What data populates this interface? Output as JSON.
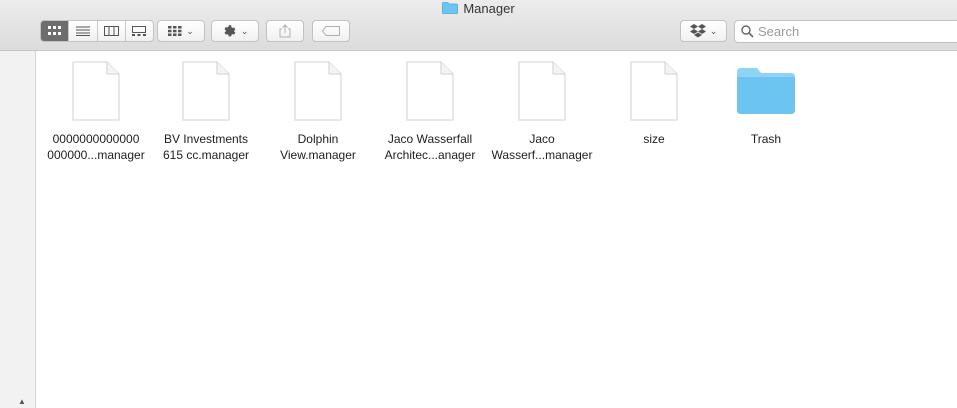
{
  "window": {
    "title": "Manager"
  },
  "toolbar": {
    "view_modes": [
      {
        "name": "icon-view",
        "active": true
      },
      {
        "name": "list-view",
        "active": false
      },
      {
        "name": "column-view",
        "active": false
      },
      {
        "name": "gallery-view",
        "active": false
      }
    ],
    "buttons": [
      "group-by",
      "action-gear",
      "share",
      "tags",
      "dropbox"
    ]
  },
  "search": {
    "placeholder": "Search",
    "value": ""
  },
  "files": [
    {
      "label": "0000000000000\n000000...manager",
      "kind": "document"
    },
    {
      "label": "BV Investments\n615 cc.manager",
      "kind": "document"
    },
    {
      "label": "Dolphin\nView.manager",
      "kind": "document"
    },
    {
      "label": "Jaco Wasserfall\nArchitec...anager",
      "kind": "document"
    },
    {
      "label": "Jaco\nWasserf...manager",
      "kind": "document"
    },
    {
      "label": "size",
      "kind": "document"
    },
    {
      "label": "Trash",
      "kind": "folder"
    }
  ],
  "colors": {
    "folder": "#6cc5f0",
    "folder_tab": "#8dd4f6",
    "accent": "#6d6d6d"
  }
}
